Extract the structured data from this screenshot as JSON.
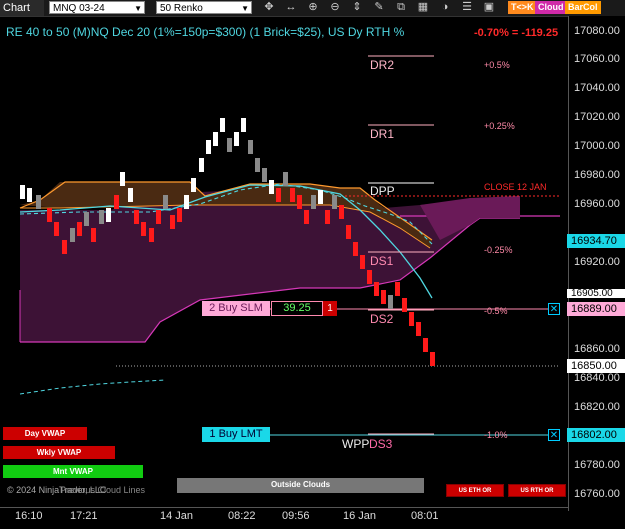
{
  "toolbar": {
    "tab_label": "Chart",
    "instrument": "MNQ 03-24",
    "bar_type": "50 Renko",
    "buttons": [
      "T<>K",
      "Cloud",
      "BarCol"
    ]
  },
  "chart": {
    "title": "RE 40 to 50 (M)NQ Dec 20 (1%=150p=$300) (1 Brick=$25), US Dy RTH %",
    "pnl": "-0.70% = -119.25",
    "close_label": "CLOSE 12 JAN",
    "copyright": "© 2024 NinjaTrader, LLC",
    "legend_text": "Previous Cloud Lines",
    "outside_clouds": "Outside Clouds"
  },
  "levels": [
    {
      "name": "DR2",
      "pct": "+0.5%"
    },
    {
      "name": "DR1",
      "pct": "+0.25%"
    },
    {
      "name": "DPP",
      "pct": "-0.25%"
    },
    {
      "name": "DS1",
      "pct": ""
    },
    {
      "name": "DS2",
      "pct": "-0.5%"
    },
    {
      "name": "WPP",
      "pct": ""
    },
    {
      "name": "DS3",
      "pct": "-1.0%"
    }
  ],
  "orders": {
    "sell": {
      "label": "2 Buy SLM",
      "price": "39.25",
      "qty": "1"
    },
    "buy": {
      "label": "1 Buy LMT"
    }
  },
  "price_axis": [
    "17080.00",
    "17060.00",
    "17040.00",
    "17020.00",
    "17000.00",
    "16980.00",
    "16960.00",
    "16920.00",
    "16900.00",
    "16860.00",
    "16840.00",
    "16820.00",
    "16800.00",
    "16780.00",
    "16760.00"
  ],
  "price_boxes": {
    "current": "16934.70",
    "order1": "16889.00",
    "order2": "16850.00",
    "order3": "16802.00",
    "partial": "16905.00"
  },
  "time_axis": [
    "16:10",
    "17:21",
    "14 Jan",
    "08:22",
    "09:56",
    "16 Jan",
    "08:01"
  ],
  "vwap_buttons": [
    "Day VWAP",
    "Wkly VWAP",
    "Mnt VWAP"
  ],
  "session_buttons": [
    "US ETH OR",
    "US RTH OR"
  ],
  "colors": {
    "up": "#ffffff",
    "down": "#ff1a1a",
    "gray": "#888888",
    "cloud": "#4a1540",
    "cyan": "#4fd6e0",
    "orange": "#ff9a2e"
  }
}
